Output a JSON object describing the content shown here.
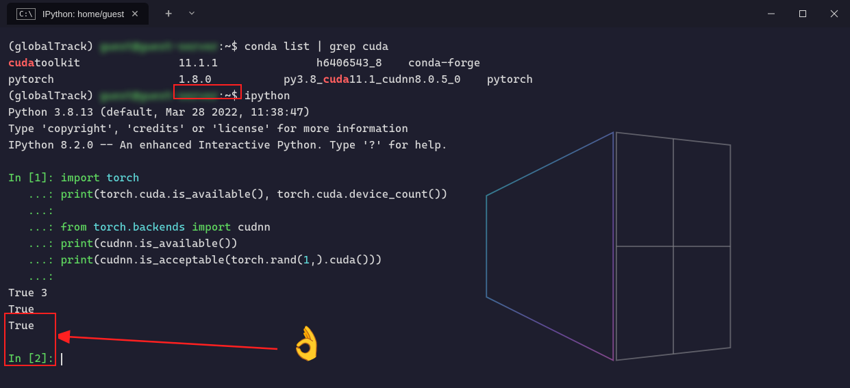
{
  "tab": {
    "title": "IPython: home/guest"
  },
  "shell": {
    "env": "(globalTrack)",
    "user_blurred": "guest@guest-server",
    "prompt": ":~$",
    "cmd1": " conda list | grep cuda",
    "cmd2": " ipython"
  },
  "conda": {
    "pkg1_a": "cuda",
    "pkg1_b": "toolkit",
    "pkg1_ver": "11.1.1",
    "pkg1_build": "h6406543_8",
    "pkg1_chan": "conda-forge",
    "pkg2_name": "pytorch",
    "pkg2_ver": "1.8.0",
    "pkg2_build_a": "py3.8_",
    "pkg2_build_cuda": "cuda",
    "pkg2_build_b": "11.1_cudnn8.0.5_0",
    "pkg2_chan": "pytorch"
  },
  "python": {
    "banner1": "Python 3.8.13 (default, Mar 28 2022, 11:38:47)",
    "banner2": "Type 'copyright', 'credits' or 'license' for more information",
    "banner3": "IPython 8.2.0 -- An enhanced Interactive Python. Type '?' for help."
  },
  "ipy": {
    "in_open": "In [",
    "in_close": "]: ",
    "n1": "1",
    "n2": "2",
    "cont": "   ...: ",
    "kw_import": "import",
    "kw_from": "from",
    "mod_torch": "torch",
    "mod_backends": "torch.backends",
    "id_cudnn": "cudnn",
    "fn_print": "print",
    "call1": "(torch.cuda.is_available(), torch.cuda.device_count())",
    "call2": "(cudnn.is_available())",
    "call3_a": "(cudnn.is_acceptable(torch.rand(",
    "call3_num": "1",
    "call3_b": ",).cuda()))"
  },
  "output": {
    "l1": "True 3",
    "l2": "True",
    "l3": "True"
  },
  "emoji": "👌"
}
